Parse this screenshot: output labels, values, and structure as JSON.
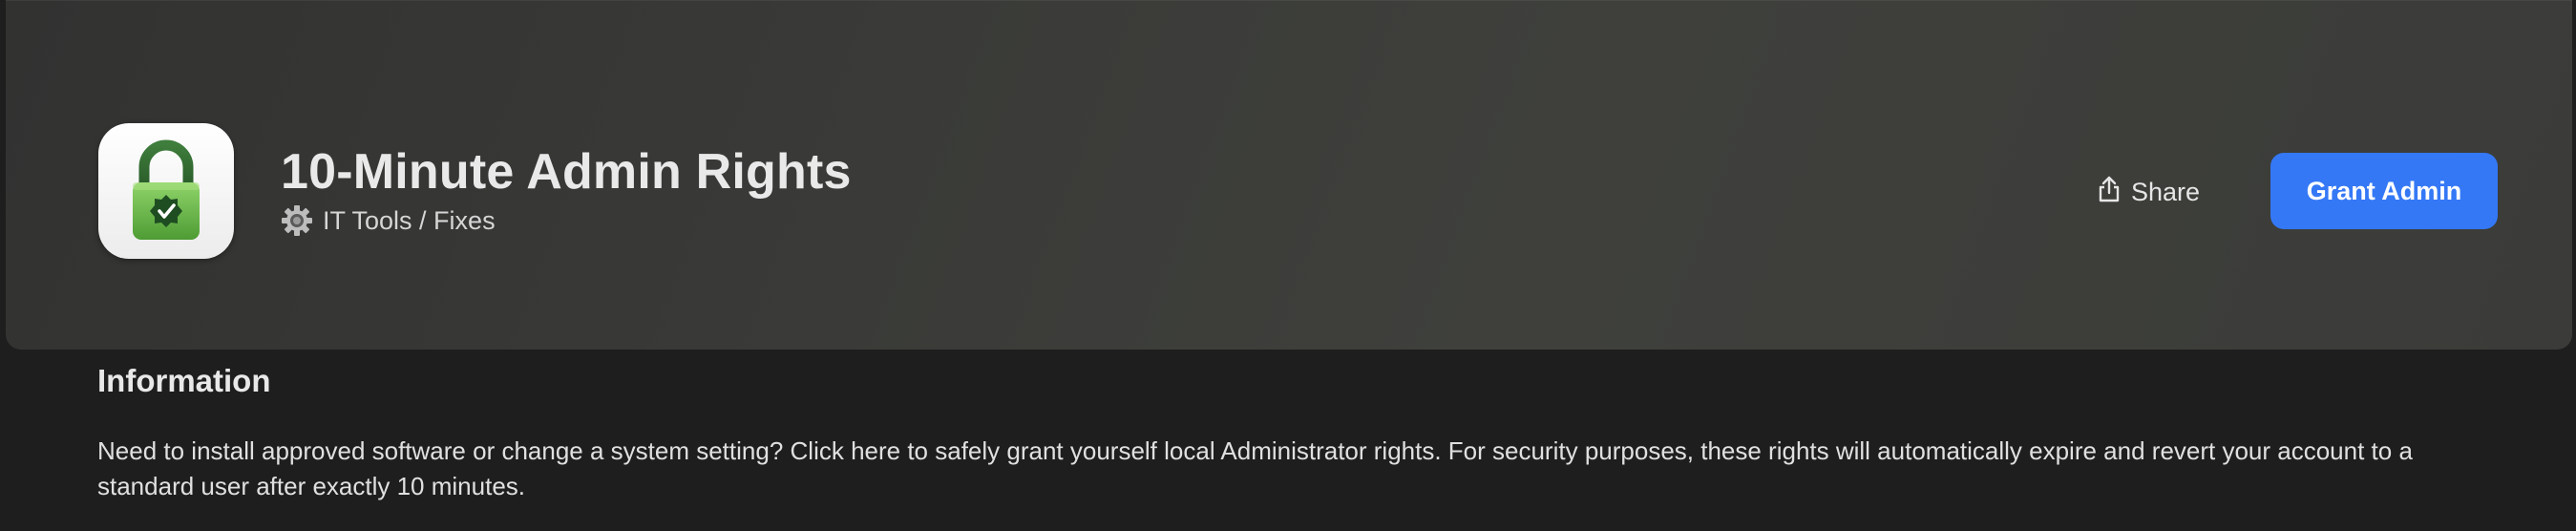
{
  "app": {
    "title": "10-Minute Admin Rights",
    "category": "IT Tools / Fixes",
    "category_icon": "gear-icon",
    "app_icon": "padlock-checkmark-icon"
  },
  "actions": {
    "share_label": "Share",
    "share_icon": "share-icon",
    "grant_label": "Grant Admin"
  },
  "information": {
    "heading": "Information",
    "body": "Need to install approved software or change a system setting? Click here to safely grant yourself local Administrator rights. For security purposes, these rights will automatically expire and revert your account to a standard user after exactly 10 minutes."
  },
  "colors": {
    "accent": "#3478f6",
    "background": "#1e1e1e",
    "banner": "#3b3c39",
    "icon_green": "#6fbe47",
    "icon_dark_green": "#2e6a30"
  }
}
